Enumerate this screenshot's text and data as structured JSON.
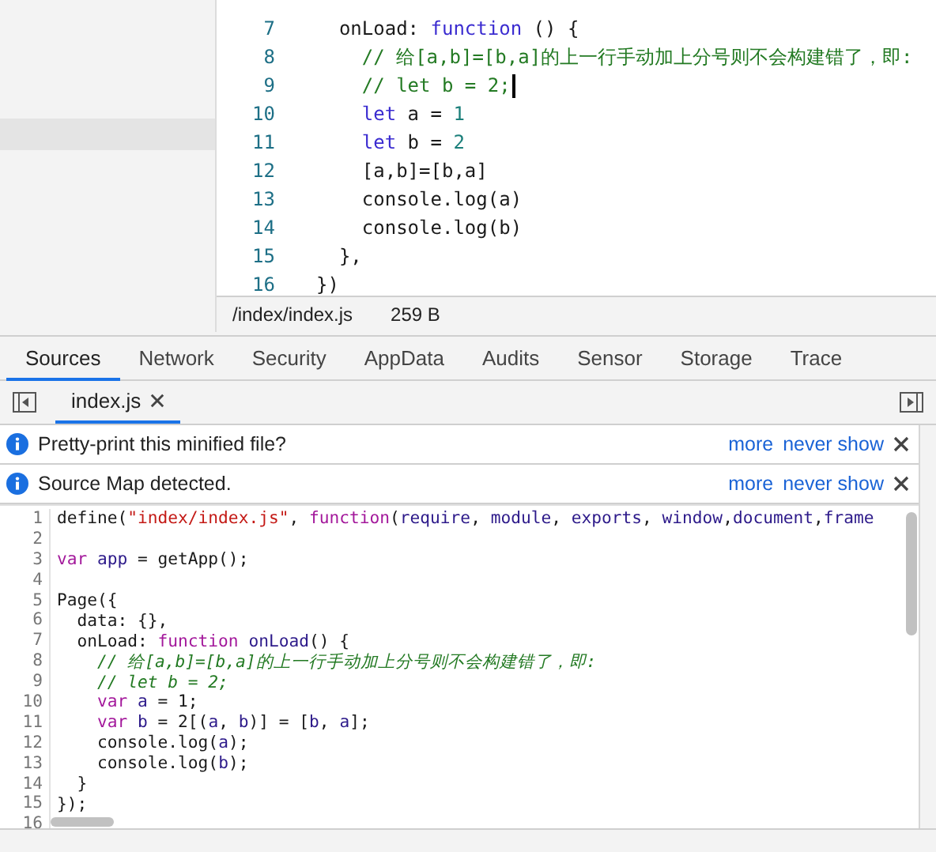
{
  "editor": {
    "lines": [
      {
        "number": "7",
        "cursor": false,
        "tokens": [
          {
            "kind": "plain",
            "text": "  onLoad: "
          },
          {
            "kind": "keyword",
            "text": "function"
          },
          {
            "kind": "plain",
            "text": " () {"
          }
        ]
      },
      {
        "number": "8",
        "cursor": false,
        "tokens": [
          {
            "kind": "comment",
            "text": "    // 给[a,b]=[b,a]的上一行手动加上分号则不会构建错了，即:"
          }
        ]
      },
      {
        "number": "9",
        "cursor": true,
        "tokens": [
          {
            "kind": "comment",
            "text": "    // let b = 2;"
          }
        ]
      },
      {
        "number": "10",
        "cursor": false,
        "tokens": [
          {
            "kind": "keyword",
            "text": "    let"
          },
          {
            "kind": "plain",
            "text": " a = "
          },
          {
            "kind": "number",
            "text": "1"
          }
        ]
      },
      {
        "number": "11",
        "cursor": false,
        "tokens": [
          {
            "kind": "keyword",
            "text": "    let"
          },
          {
            "kind": "plain",
            "text": " b = "
          },
          {
            "kind": "number",
            "text": "2"
          }
        ]
      },
      {
        "number": "12",
        "cursor": false,
        "tokens": [
          {
            "kind": "plain",
            "text": "    [a,b]=[b,a]"
          }
        ]
      },
      {
        "number": "13",
        "cursor": false,
        "tokens": [
          {
            "kind": "plain",
            "text": "    console.log(a)"
          }
        ]
      },
      {
        "number": "14",
        "cursor": false,
        "tokens": [
          {
            "kind": "plain",
            "text": "    console.log(b)"
          }
        ]
      },
      {
        "number": "15",
        "cursor": false,
        "tokens": [
          {
            "kind": "plain",
            "text": "  },"
          }
        ]
      },
      {
        "number": "16",
        "cursor": false,
        "tokens": [
          {
            "kind": "plain",
            "text": "})"
          }
        ]
      }
    ],
    "status": {
      "path": "/index/index.js",
      "size": "259 B"
    }
  },
  "tabs": [
    {
      "label": "Sources",
      "selected": true
    },
    {
      "label": "Network",
      "selected": false
    },
    {
      "label": "Security",
      "selected": false
    },
    {
      "label": "AppData",
      "selected": false
    },
    {
      "label": "Audits",
      "selected": false
    },
    {
      "label": "Sensor",
      "selected": false
    },
    {
      "label": "Storage",
      "selected": false
    },
    {
      "label": "Trace",
      "selected": false
    }
  ],
  "file_tabs": [
    {
      "label": "index.js",
      "selected": true
    }
  ],
  "infobars": [
    {
      "message": "Pretty-print this minified file?",
      "links": [
        "more",
        "never show"
      ]
    },
    {
      "message": "Source Map detected.",
      "links": [
        "more",
        "never show"
      ]
    }
  ],
  "source": {
    "lines": [
      {
        "number": "1",
        "tokens": [
          {
            "kind": "plain",
            "text": "define("
          },
          {
            "kind": "string",
            "text": "\"index/index.js\""
          },
          {
            "kind": "plain",
            "text": ", "
          },
          {
            "kind": "keyword",
            "text": "function"
          },
          {
            "kind": "plain",
            "text": "("
          },
          {
            "kind": "name",
            "text": "require"
          },
          {
            "kind": "plain",
            "text": ", "
          },
          {
            "kind": "name",
            "text": "module"
          },
          {
            "kind": "plain",
            "text": ", "
          },
          {
            "kind": "name",
            "text": "exports"
          },
          {
            "kind": "plain",
            "text": ", "
          },
          {
            "kind": "name",
            "text": "window"
          },
          {
            "kind": "plain",
            "text": ","
          },
          {
            "kind": "name",
            "text": "document"
          },
          {
            "kind": "plain",
            "text": ","
          },
          {
            "kind": "name",
            "text": "frame"
          }
        ]
      },
      {
        "number": "2"
      },
      {
        "number": "3",
        "tokens": [
          {
            "kind": "keyword",
            "text": "var"
          },
          {
            "kind": "name",
            "text": " app"
          },
          {
            "kind": "plain",
            "text": " = getApp();"
          }
        ]
      },
      {
        "number": "4"
      },
      {
        "number": "5",
        "tokens": [
          {
            "kind": "plain",
            "text": "Page({"
          }
        ]
      },
      {
        "number": "6",
        "tokens": [
          {
            "kind": "plain",
            "text": "  data: {},"
          }
        ]
      },
      {
        "number": "7",
        "tokens": [
          {
            "kind": "plain",
            "text": "  onLoad: "
          },
          {
            "kind": "keyword",
            "text": "function"
          },
          {
            "kind": "name",
            "text": " onLoad"
          },
          {
            "kind": "plain",
            "text": "() {"
          }
        ]
      },
      {
        "number": "8",
        "tokens": [
          {
            "kind": "comment",
            "text": "    // 给[a,b]=[b,a]的上一行手动加上分号则不会构建错了，即:"
          }
        ]
      },
      {
        "number": "9",
        "tokens": [
          {
            "kind": "comment",
            "text": "    // let b = 2;"
          }
        ]
      },
      {
        "number": "10",
        "tokens": [
          {
            "kind": "keyword",
            "text": "    var"
          },
          {
            "kind": "name",
            "text": " a"
          },
          {
            "kind": "plain",
            "text": " = 1;"
          }
        ]
      },
      {
        "number": "11",
        "tokens": [
          {
            "kind": "keyword",
            "text": "    var"
          },
          {
            "kind": "name",
            "text": " b"
          },
          {
            "kind": "plain",
            "text": " = 2[("
          },
          {
            "kind": "name",
            "text": "a"
          },
          {
            "kind": "plain",
            "text": ", "
          },
          {
            "kind": "name",
            "text": "b"
          },
          {
            "kind": "plain",
            "text": ")] = ["
          },
          {
            "kind": "name",
            "text": "b"
          },
          {
            "kind": "plain",
            "text": ", "
          },
          {
            "kind": "name",
            "text": "a"
          },
          {
            "kind": "plain",
            "text": "];"
          }
        ]
      },
      {
        "number": "12",
        "tokens": [
          {
            "kind": "plain",
            "text": "    console.log("
          },
          {
            "kind": "name",
            "text": "a"
          },
          {
            "kind": "plain",
            "text": ");"
          }
        ]
      },
      {
        "number": "13",
        "tokens": [
          {
            "kind": "plain",
            "text": "    console.log("
          },
          {
            "kind": "name",
            "text": "b"
          },
          {
            "kind": "plain",
            "text": ");"
          }
        ]
      },
      {
        "number": "14",
        "tokens": [
          {
            "kind": "plain",
            "text": "  }"
          }
        ]
      },
      {
        "number": "15",
        "tokens": [
          {
            "kind": "plain",
            "text": "});"
          }
        ]
      },
      {
        "number": "16"
      }
    ]
  }
}
